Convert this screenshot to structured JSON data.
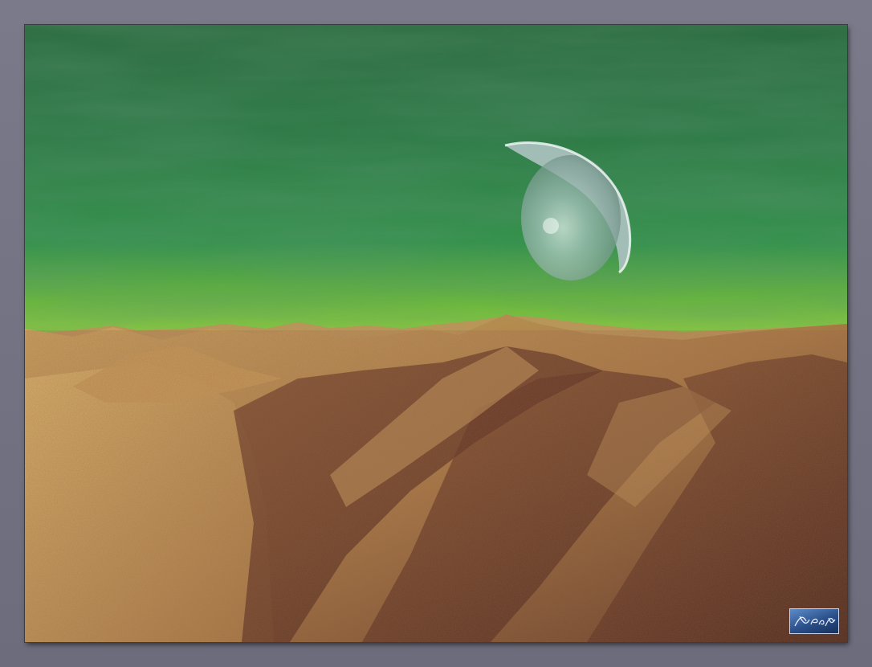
{
  "scene": {
    "description_icon": "planet-icon",
    "watermark": {
      "text": "X-PaX",
      "icon": "signature-logo-icon"
    },
    "colors": {
      "frame": "#6f6f7f",
      "sky_top": "#2a6a3e",
      "sky_mid": "#2f8a4a",
      "horizon_glow": "#8ed23a",
      "terrain_light": "#c9a35c",
      "terrain_shadow": "#5a2f1e",
      "planet": "#b9cfcf"
    }
  }
}
